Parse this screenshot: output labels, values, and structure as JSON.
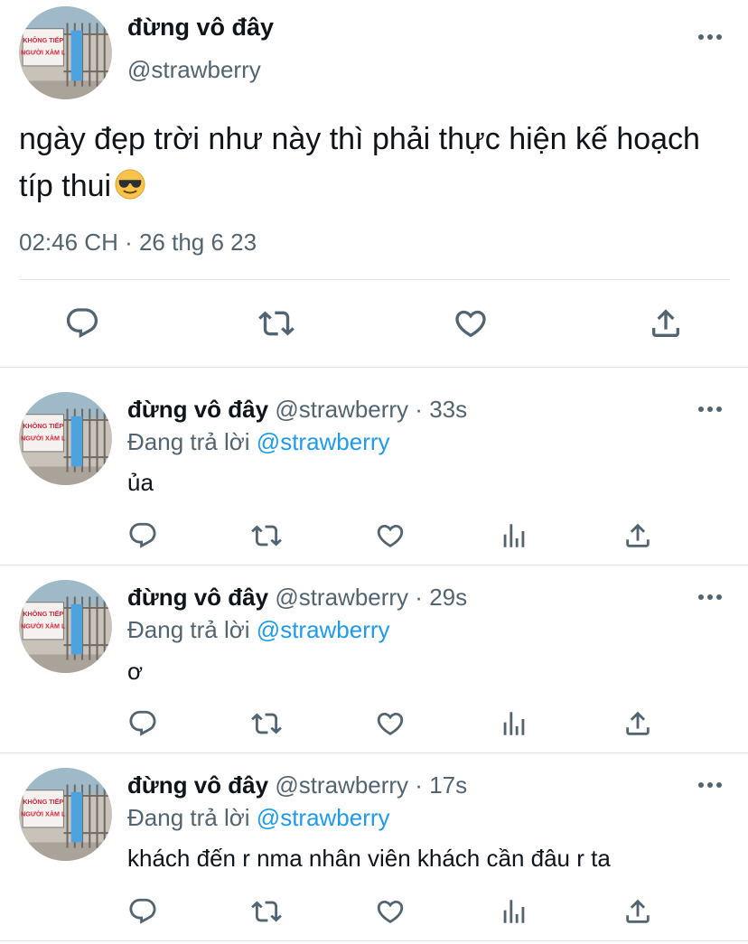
{
  "main_tweet": {
    "display_name": "đừng vô đây",
    "handle": "@strawberry",
    "text": "ngày đẹp trời như này thì phải thực hiện kế hoạch típ thui",
    "emoji": "smiling-face-with-sunglasses",
    "timestamp": "02:46 CH · 26 thg 6 23",
    "avatar_sign": [
      "KHÔNG TIẾP",
      "NGƯỜI XÀM L"
    ]
  },
  "replies": [
    {
      "display_name": "đừng vô đây",
      "handle": "@strawberry",
      "age": "33s",
      "replying_prefix": "Đang trả lời",
      "replying_to": "@strawberry",
      "text": "ủa"
    },
    {
      "display_name": "đừng vô đây",
      "handle": "@strawberry",
      "age": "29s",
      "replying_prefix": "Đang trả lời",
      "replying_to": "@strawberry",
      "text": "ơ"
    },
    {
      "display_name": "đừng vô đây",
      "handle": "@strawberry",
      "age": "17s",
      "replying_prefix": "Đang trả lời",
      "replying_to": "@strawberry",
      "text": "khách đến r nma nhân viên khách cần đâu r ta"
    }
  ],
  "colors": {
    "text": "#0f1419",
    "muted": "#536471",
    "link": "#1d9bf0",
    "divider": "#e1e4e8"
  },
  "icons": [
    "reply-icon",
    "retweet-icon",
    "like-icon",
    "share-icon",
    "views-icon",
    "more-icon"
  ]
}
